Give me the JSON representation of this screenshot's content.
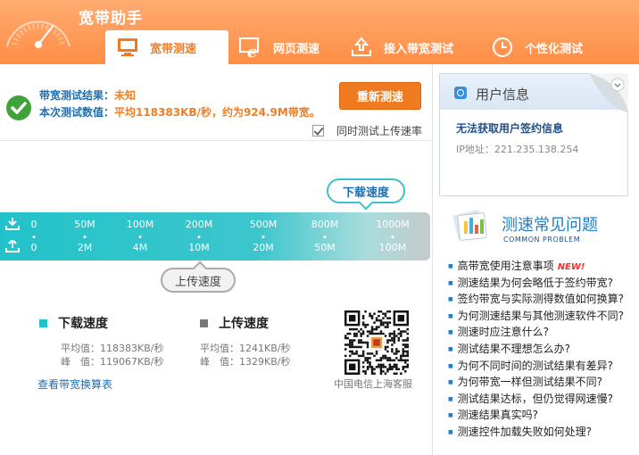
{
  "app": {
    "title": "宽带助手"
  },
  "tabs": [
    {
      "label": "宽带测速",
      "icon": "monitor-icon"
    },
    {
      "label": "网页测速",
      "icon": "ie-icon"
    },
    {
      "label": "接入带宽测试",
      "icon": "upload-tray-icon"
    },
    {
      "label": "个性化测试",
      "icon": "clock-icon"
    }
  ],
  "result": {
    "bandwidth_label": "带宽测试结果：",
    "bandwidth_value": "未知",
    "value_label": "本次测试数值：",
    "value_text": "平均118383KB/秒，约为924.9M带宽。",
    "retest_button": "重新测速",
    "upload_option_label": "同时测试上传速率",
    "upload_option_checked": true
  },
  "scale": {
    "download_bubble": "下载速度",
    "upload_bubble": "上传速度",
    "download_ticks": [
      "0",
      "50M",
      "100M",
      "200M",
      "500M",
      "800M",
      "1000M"
    ],
    "upload_ticks": [
      "0",
      "2M",
      "4M",
      "10M",
      "20M",
      "50M",
      "100M"
    ]
  },
  "download": {
    "legend": "下载速度",
    "color": "#23c2ca",
    "avg_label": "平均值：",
    "avg_value": "118383KB/秒",
    "peak_label": "峰　值：",
    "peak_value": "119067KB/秒"
  },
  "upload": {
    "legend": "上传速度",
    "color": "#777777",
    "avg_label": "平均值：",
    "avg_value": "1241KB/秒",
    "peak_label": "峰　值：",
    "peak_value": "1329KB/秒"
  },
  "conversion_link": "查看带宽换算表",
  "qr_caption": "中国电信上海客服",
  "user_info": {
    "title": "用户信息",
    "message": "无法获取用户签约信息",
    "ip_label": "IP地址：",
    "ip_value": "221.235.138.254"
  },
  "faq": {
    "title": "测速常见问题",
    "subtitle": "COMMON PROBLEM",
    "new_badge": "NEW!",
    "items": [
      "高带宽使用注意事项",
      "测速结果为何会略低于签约带宽?",
      "签约带宽与实际测得数值如何换算?",
      "为何测速结果与其他测速软件不同?",
      "测速时应注意什么?",
      "测试结果不理想怎么办?",
      "为何不同时间的测试结果有差异?",
      "为何带宽一样但测试结果不同?",
      "测试结果达标，但仍觉得网速慢?",
      "测速结果真实吗?",
      "测速控件加载失败如何处理?"
    ]
  }
}
